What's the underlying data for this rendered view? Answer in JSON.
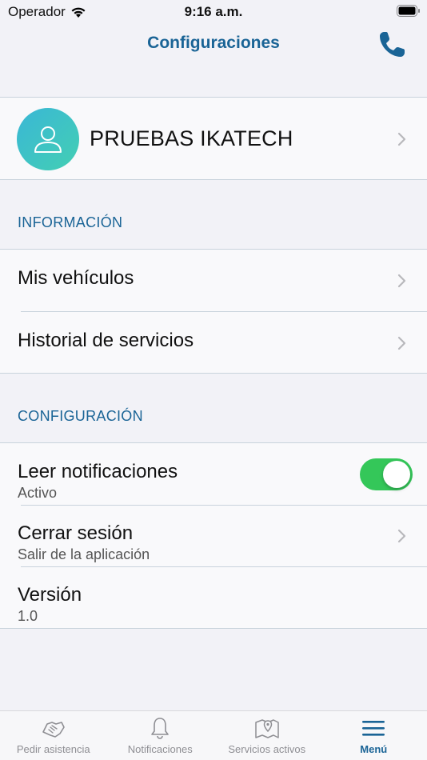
{
  "status_bar": {
    "carrier": "Operador",
    "time": "9:16 a.m."
  },
  "nav": {
    "title": "Configuraciones",
    "phone_icon": "phone-icon"
  },
  "profile": {
    "name": "PRUEBAS IKATECH"
  },
  "sections": {
    "informacion": {
      "header": "INFORMACIÓN",
      "items": [
        {
          "title": "Mis vehículos"
        },
        {
          "title": "Historial de servicios"
        }
      ]
    },
    "configuracion": {
      "header": "CONFIGURACIÓN",
      "read_notifications": {
        "title": "Leer notificaciones",
        "subtitle": "Activo",
        "enabled": true
      },
      "logout": {
        "title": "Cerrar sesión",
        "subtitle": "Salir de la aplicación"
      },
      "version": {
        "title": "Versión",
        "subtitle": "1.0"
      }
    }
  },
  "tabs": [
    {
      "label": "Pedir asistencia",
      "icon": "handshake-icon",
      "active": false
    },
    {
      "label": "Notificaciones",
      "icon": "bell-icon",
      "active": false
    },
    {
      "label": "Servicios activos",
      "icon": "map-pin-icon",
      "active": false
    },
    {
      "label": "Menú",
      "icon": "menu-icon",
      "active": true
    }
  ],
  "colors": {
    "accent": "#1a6496",
    "toggle_on": "#34c759",
    "avatar_start": "#3ab7d6",
    "avatar_end": "#43cfb3"
  }
}
